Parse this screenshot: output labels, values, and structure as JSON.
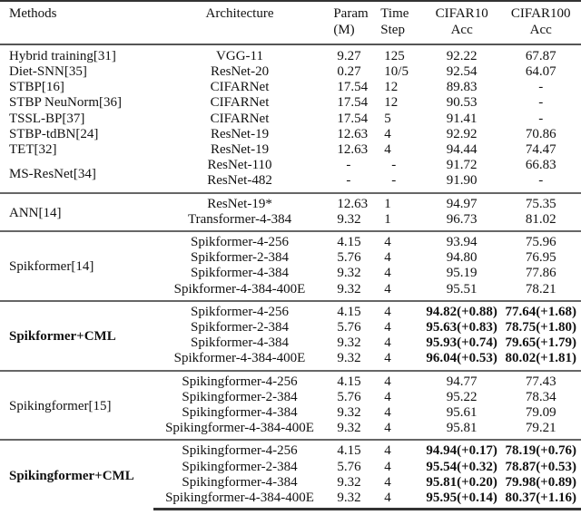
{
  "table": {
    "headers": {
      "methods": "Methods",
      "architecture": "Architecture",
      "param_line1": "Param",
      "param_line2": "(M)",
      "time_line1": "Time",
      "time_line2": "Step",
      "cifar10_line1": "CIFAR10",
      "cifar10_line2": "Acc",
      "cifar100_line1": "CIFAR100",
      "cifar100_line2": "Acc"
    },
    "groups": [
      {
        "rows": [
          {
            "method": "Hybrid training[31]",
            "arch": "VGG-11",
            "param": "9.27",
            "time": "125",
            "c10": "92.22",
            "c100": "67.87"
          },
          {
            "method": "Diet-SNN[35]",
            "arch": "ResNet-20",
            "param": "0.27",
            "time": "10/5",
            "c10": "92.54",
            "c100": "64.07"
          },
          {
            "method": "STBP[16]",
            "arch": "CIFARNet",
            "param": "17.54",
            "time": "12",
            "c10": "89.83",
            "c100": "-"
          },
          {
            "method": "STBP NeuNorm[36]",
            "arch": "CIFARNet",
            "param": "17.54",
            "time": "12",
            "c10": "90.53",
            "c100": "-"
          },
          {
            "method": "TSSL-BP[37]",
            "arch": "CIFARNet",
            "param": "17.54",
            "time": "5",
            "c10": "91.41",
            "c100": "-"
          },
          {
            "method": "STBP-tdBN[24]",
            "arch": "ResNet-19",
            "param": "12.63",
            "time": "4",
            "c10": "92.92",
            "c100": "70.86"
          },
          {
            "method": "TET[32]",
            "arch": "ResNet-19",
            "param": "12.63",
            "time": "4",
            "c10": "94.44",
            "c100": "74.47"
          }
        ],
        "ms_resnet": {
          "method": "MS-ResNet[34]",
          "rows": [
            {
              "arch": "ResNet-110",
              "param": "-",
              "time": "-",
              "c10": "91.72",
              "c100": "66.83"
            },
            {
              "arch": "ResNet-482",
              "param": "-",
              "time": "-",
              "c10": "91.90",
              "c100": "-"
            }
          ]
        }
      },
      {
        "method": "ANN[14]",
        "bold": false,
        "rows": [
          {
            "arch": "ResNet-19*",
            "param": "12.63",
            "time": "1",
            "c10": "94.97",
            "c100": "75.35"
          },
          {
            "arch": "Transformer-4-384",
            "param": "9.32",
            "time": "1",
            "c10": "96.73",
            "c100": "81.02"
          }
        ]
      },
      {
        "method": "Spikformer[14]",
        "bold": false,
        "rows": [
          {
            "arch": "Spikformer-4-256",
            "param": "4.15",
            "time": "4",
            "c10": "93.94",
            "c100": "75.96"
          },
          {
            "arch": "Spikformer-2-384",
            "param": "5.76",
            "time": "4",
            "c10": "94.80",
            "c100": "76.95"
          },
          {
            "arch": "Spikformer-4-384",
            "param": "9.32",
            "time": "4",
            "c10": "95.19",
            "c100": "77.86"
          },
          {
            "arch": "Spikformer-4-384-400E",
            "param": "9.32",
            "time": "4",
            "c10": "95.51",
            "c100": "78.21"
          }
        ]
      },
      {
        "method": "Spikformer+CML",
        "bold": true,
        "rows": [
          {
            "arch": "Spikformer-4-256",
            "param": "4.15",
            "time": "4",
            "c10": "94.82(+0.88)",
            "c100": "77.64(+1.68)"
          },
          {
            "arch": "Spikformer-2-384",
            "param": "5.76",
            "time": "4",
            "c10": "95.63(+0.83)",
            "c100": "78.75(+1.80)"
          },
          {
            "arch": "Spikformer-4-384",
            "param": "9.32",
            "time": "4",
            "c10": "95.93(+0.74)",
            "c100": "79.65(+1.79)"
          },
          {
            "arch": "Spikformer-4-384-400E",
            "param": "9.32",
            "time": "4",
            "c10": "96.04(+0.53)",
            "c100": "80.02(+1.81)"
          }
        ]
      },
      {
        "method": "Spikingformer[15]",
        "bold": false,
        "rows": [
          {
            "arch": "Spikingformer-4-256",
            "param": "4.15",
            "time": "4",
            "c10": "94.77",
            "c100": "77.43"
          },
          {
            "arch": "Spikingformer-2-384",
            "param": "5.76",
            "time": "4",
            "c10": "95.22",
            "c100": "78.34"
          },
          {
            "arch": "Spikingformer-4-384",
            "param": "9.32",
            "time": "4",
            "c10": "95.61",
            "c100": "79.09"
          },
          {
            "arch": "Spikingformer-4-384-400E",
            "param": "9.32",
            "time": "4",
            "c10": "95.81",
            "c100": "79.21"
          }
        ]
      },
      {
        "method": "Spikingformer+CML",
        "bold": true,
        "rows": [
          {
            "arch": "Spikingformer-4-256",
            "param": "4.15",
            "time": "4",
            "c10": "94.94(+0.17)",
            "c100": "78.19(+0.76)"
          },
          {
            "arch": "Spikingformer-2-384",
            "param": "5.76",
            "time": "4",
            "c10": "95.54(+0.32)",
            "c100": "78.87(+0.53)"
          },
          {
            "arch": "Spikingformer-4-384",
            "param": "9.32",
            "time": "4",
            "c10": "95.81(+0.20)",
            "c100": "79.98(+0.89)"
          },
          {
            "arch": "Spikingformer-4-384-400E",
            "param": "9.32",
            "time": "4",
            "c10": "95.95(+0.14)",
            "c100": "80.37(+1.16)"
          }
        ]
      }
    ]
  }
}
